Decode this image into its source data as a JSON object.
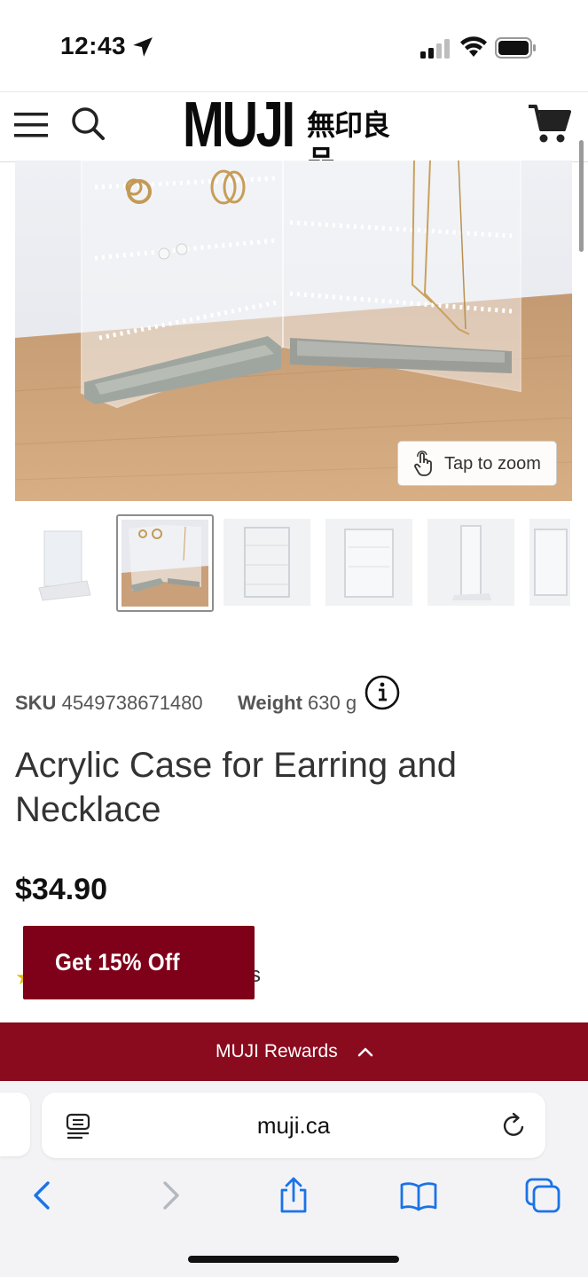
{
  "status_bar": {
    "time": "12:43"
  },
  "header": {
    "logo_latin": "MUJI",
    "logo_kanji": "無印良品"
  },
  "product_image": {
    "zoom_label": "Tap to zoom",
    "thumbnail_count": 6,
    "active_thumbnail": 2
  },
  "product": {
    "sku_label": "SKU",
    "sku_value": "4549738671480",
    "weight_label": "Weight",
    "weight_value": "630 g",
    "title": "Acrylic Case for Earring and Necklace",
    "price": "$34.90",
    "reviews_tail": "s",
    "stars": "★"
  },
  "promo": {
    "label": "Get 15% Off"
  },
  "rewards": {
    "label": "MUJI Rewards"
  },
  "browser": {
    "url": "muji.ca"
  },
  "colors": {
    "brand_red": "#7f0019",
    "rewards_bar": "#8a0a1e",
    "ios_blue": "#1a73e8"
  },
  "icons": [
    "location-arrow-icon",
    "cellular-signal-icon",
    "wifi-icon",
    "battery-icon",
    "hamburger-menu-icon",
    "search-icon",
    "cart-icon",
    "tap-hand-icon",
    "info-icon",
    "chevron-up-icon",
    "reader-mode-icon",
    "reload-icon",
    "back-arrow-icon",
    "forward-arrow-icon",
    "share-icon",
    "bookmarks-icon",
    "tabs-icon"
  ]
}
